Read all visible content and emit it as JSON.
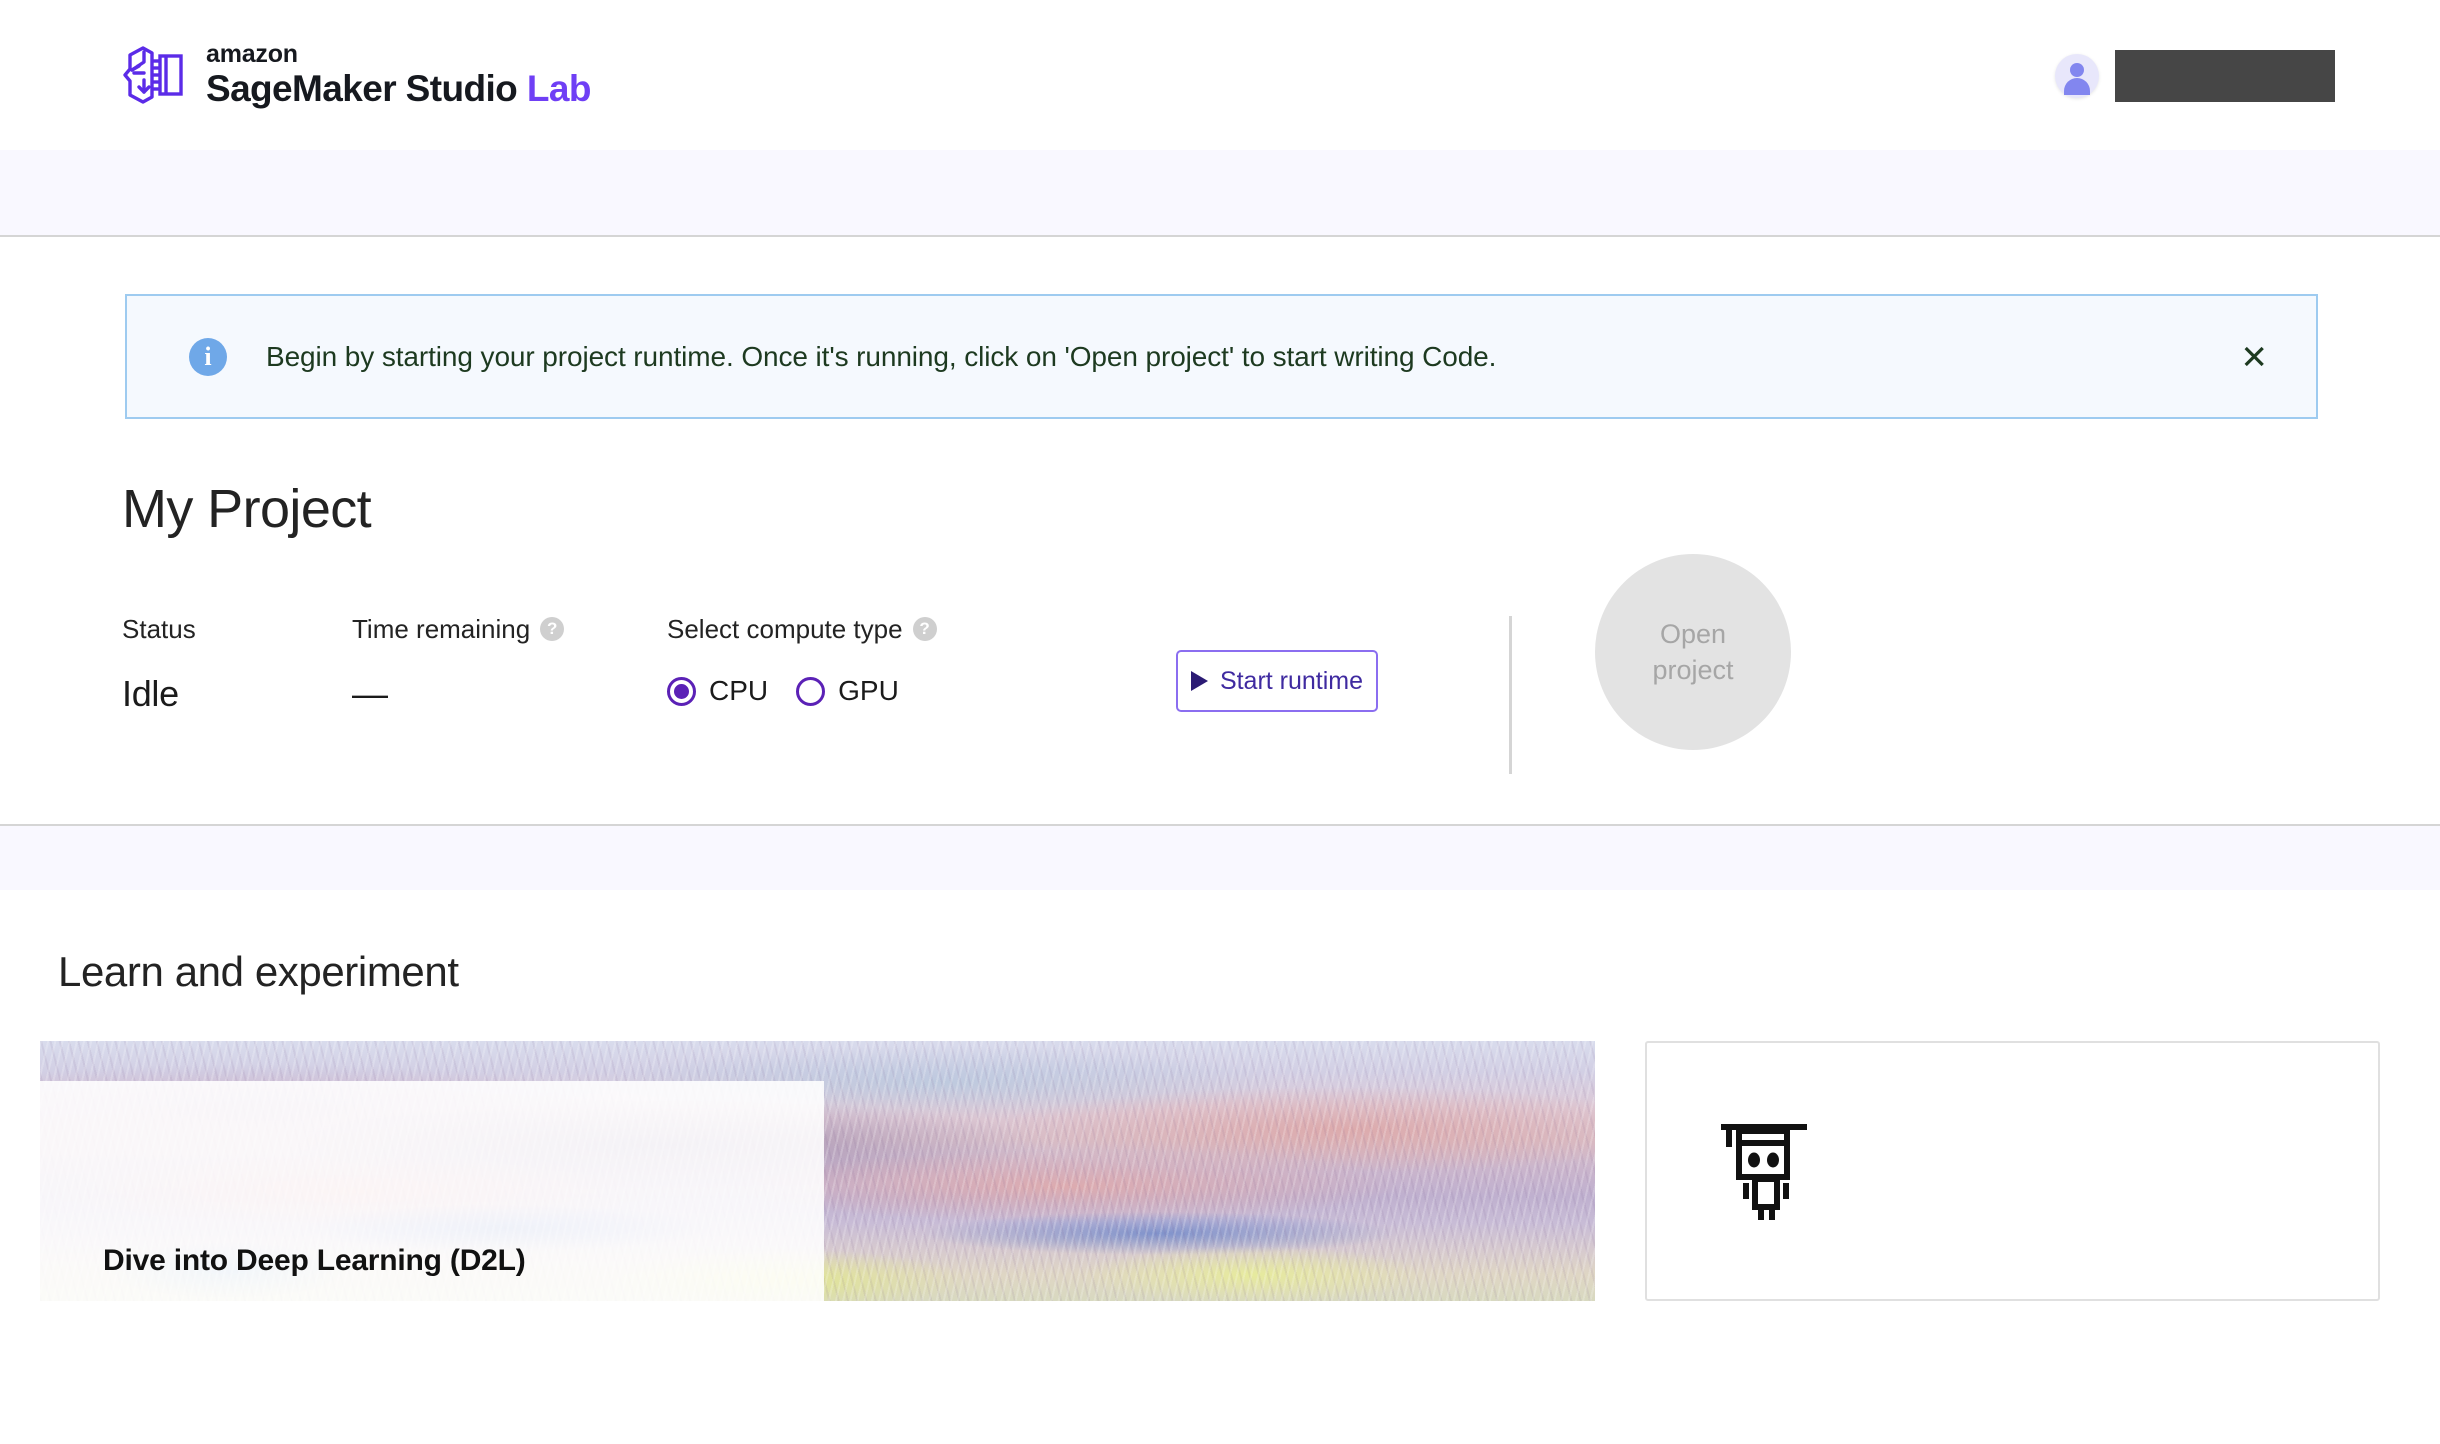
{
  "header": {
    "logo_icon": "sagemaker-brain-chip-logo",
    "brand_amazon": "amazon",
    "brand_product": "SageMaker Studio ",
    "brand_product_accent": "Lab",
    "avatar_icon": "user-avatar-icon",
    "user_name": ""
  },
  "banner": {
    "icon": "info-circle-icon",
    "message": "Begin by starting your project runtime. Once it's running, click on 'Open project' to start writing Code.",
    "close_icon": "close-icon",
    "close_label": "✕",
    "border_color": "#9ecbf0",
    "background_color": "#f5f9fe",
    "text_color": "#1d3a20"
  },
  "project": {
    "title": "My Project",
    "status": {
      "label": "Status",
      "value": "Idle"
    },
    "time_remaining": {
      "label": "Time remaining",
      "help_icon": "help-circle-icon",
      "help_label": "?",
      "value": "—"
    },
    "compute_type": {
      "label": "Select compute type",
      "help_icon": "help-circle-icon",
      "help_label": "?",
      "options": [
        {
          "label": "CPU",
          "selected": true
        },
        {
          "label": "GPU",
          "selected": false
        }
      ]
    },
    "start_runtime_button": {
      "label": "Start runtime",
      "icon": "play-icon",
      "border_color": "#8b6ef0",
      "text_color": "#3f2aa0"
    },
    "open_project_button": {
      "line1": "Open",
      "line2": "project",
      "disabled": true,
      "background_color": "#e3e3e3",
      "text_color": "#a6a6a6"
    }
  },
  "learn": {
    "title": "Learn and experiment",
    "cards": [
      {
        "name": "d2l-card",
        "title": "Dive into Deep Learning (D2L)",
        "image_alt": "pastel-painted-mountain-landscape"
      },
      {
        "name": "robot-card",
        "icon": "graduate-robot-icon",
        "title": ""
      }
    ]
  },
  "colors": {
    "brand_purple": "#6f3ff5",
    "radio_purple": "#5b21b6",
    "subbar_background": "#f9f8ff",
    "divider": "#d5d5d5"
  }
}
